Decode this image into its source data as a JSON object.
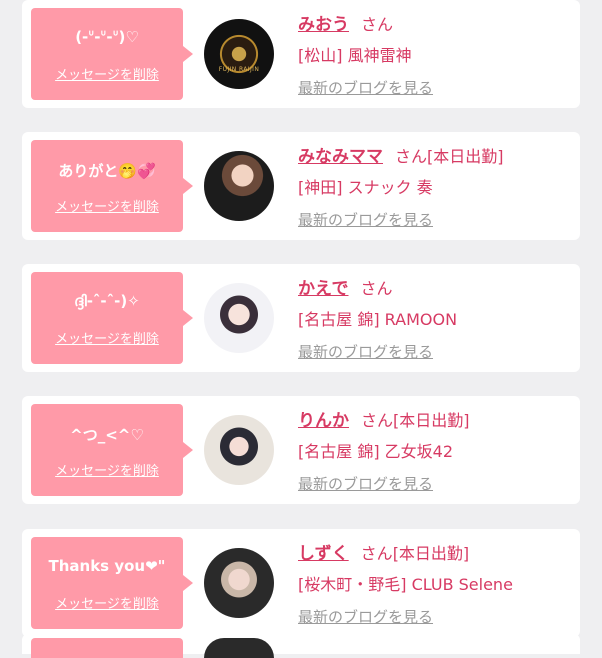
{
  "colors": {
    "background": "#efeff1",
    "card": "#ffffff",
    "bubble": "#ff9aa8",
    "accent": "#d73a63",
    "muted": "#9a9a9a"
  },
  "messages": [
    {
      "bubble_text": "(-ᐡ-ᐡ-ᐡ)♡",
      "delete_label": "メッセージを削除",
      "name": "みおう",
      "suffix": "さん",
      "status": "",
      "shop": "[松山] 風神雷神",
      "avatar_label": "FUJIN RAIJIN",
      "blog_link": "最新のブログを見る"
    },
    {
      "bubble_text": "ありがと🤭💞",
      "delete_label": "メッセージを削除",
      "name": "みなみママ",
      "suffix": "さん",
      "status": "[本日出勤]",
      "shop": "[神田] スナック 奏",
      "avatar_label": "",
      "blog_link": "最新のブログを見る"
    },
    {
      "bubble_text": "ദ്ദി-ˆ-ˆ-)✧",
      "delete_label": "メッセージを削除",
      "name": "かえで",
      "suffix": "さん",
      "status": "",
      "shop": "[名古屋 錦] RAMOON",
      "avatar_label": "",
      "blog_link": "最新のブログを見る"
    },
    {
      "bubble_text": "^つ_<^♡",
      "delete_label": "メッセージを削除",
      "name": "りんか",
      "suffix": "さん",
      "status": "[本日出勤]",
      "shop": "[名古屋 錦] 乙女坂42",
      "avatar_label": "",
      "blog_link": "最新のブログを見る"
    },
    {
      "bubble_text": "Thanks you❤\"",
      "delete_label": "メッセージを削除",
      "name": "しずく",
      "suffix": "さん",
      "status": "[本日出勤]",
      "shop": "[桜木町・野毛] CLUB Selene",
      "avatar_label": "",
      "blog_link": "最新のブログを見る"
    }
  ]
}
